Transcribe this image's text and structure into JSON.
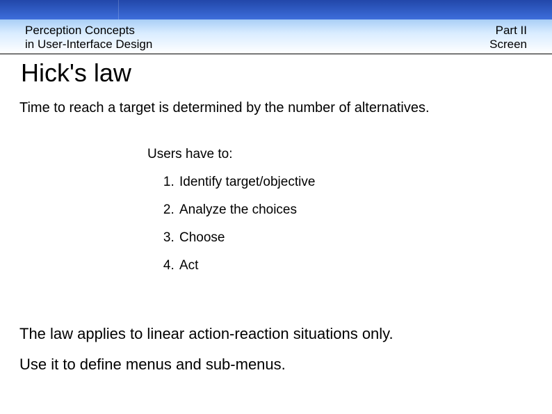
{
  "header": {
    "left_line1": "Perception Concepts",
    "left_line2": "in User-Interface Design",
    "right_line1": "Part II",
    "right_line2": "Screen"
  },
  "title": "Hick's law",
  "intro": "Time to reach a target is determined by the number of alternatives.",
  "steps_lead": "Users have to:",
  "steps": {
    "s1": "Identify target/objective",
    "s2": "Analyze the choices",
    "s3": "Choose",
    "s4": "Act"
  },
  "footer": {
    "line1": "The law applies to linear action-reaction situations only.",
    "line2": "Use it to define menus and sub-menus."
  }
}
